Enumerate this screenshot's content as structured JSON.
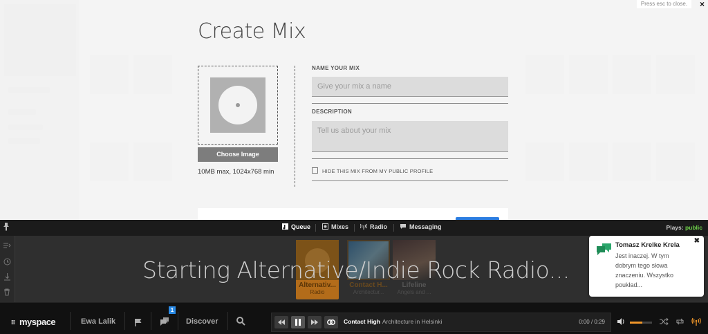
{
  "modal": {
    "esc_hint": "Press esc to close.",
    "close_icon": "×",
    "title": "Create Mix",
    "choose_image_label": "Choose Image",
    "image_note": "10MB max, 1024x768 min",
    "name_label": "NAME YOUR MIX",
    "name_placeholder": "Give your mix a name",
    "description_label": "DESCRIPTION",
    "description_placeholder": "Tell us about your mix",
    "hide_label": "HIDE THIS MIX FROM MY PUBLIC PROFILE"
  },
  "tabs": {
    "items": [
      {
        "label": "Queue",
        "icon": "queue-icon"
      },
      {
        "label": "Mixes",
        "icon": "mixes-icon"
      },
      {
        "label": "Radio",
        "icon": "radio-icon"
      },
      {
        "label": "Messaging",
        "icon": "messaging-icon"
      }
    ],
    "plays_label": "Plays:",
    "plays_value": "public"
  },
  "queue": {
    "message": "Starting Alternative/Indie Rock Radio...",
    "cards": [
      {
        "title": "Alternativ...",
        "subtitle": "Radio"
      },
      {
        "title": "Contact H...",
        "subtitle": "Architectur..."
      },
      {
        "title": "Lifeline",
        "subtitle": "Angels and ..."
      }
    ]
  },
  "notification": {
    "name": "Tomasz Krelke Krela",
    "message": "Jest inaczej. W tym dobrym tego słowa znaczeniu. Wszystko poukład..."
  },
  "bottombar": {
    "logo": "myspace",
    "user_name": "Ewa Lalik",
    "badge_count": "1",
    "discover_label": "Discover",
    "now_playing_title": "Contact High",
    "now_playing_artist": "Architecture in Helsinki",
    "time": "0:00 / 0:29"
  },
  "colors": {
    "accent_orange": "#f0962a",
    "plays_green": "#6fd34a",
    "badge_blue": "#2b8be6"
  }
}
